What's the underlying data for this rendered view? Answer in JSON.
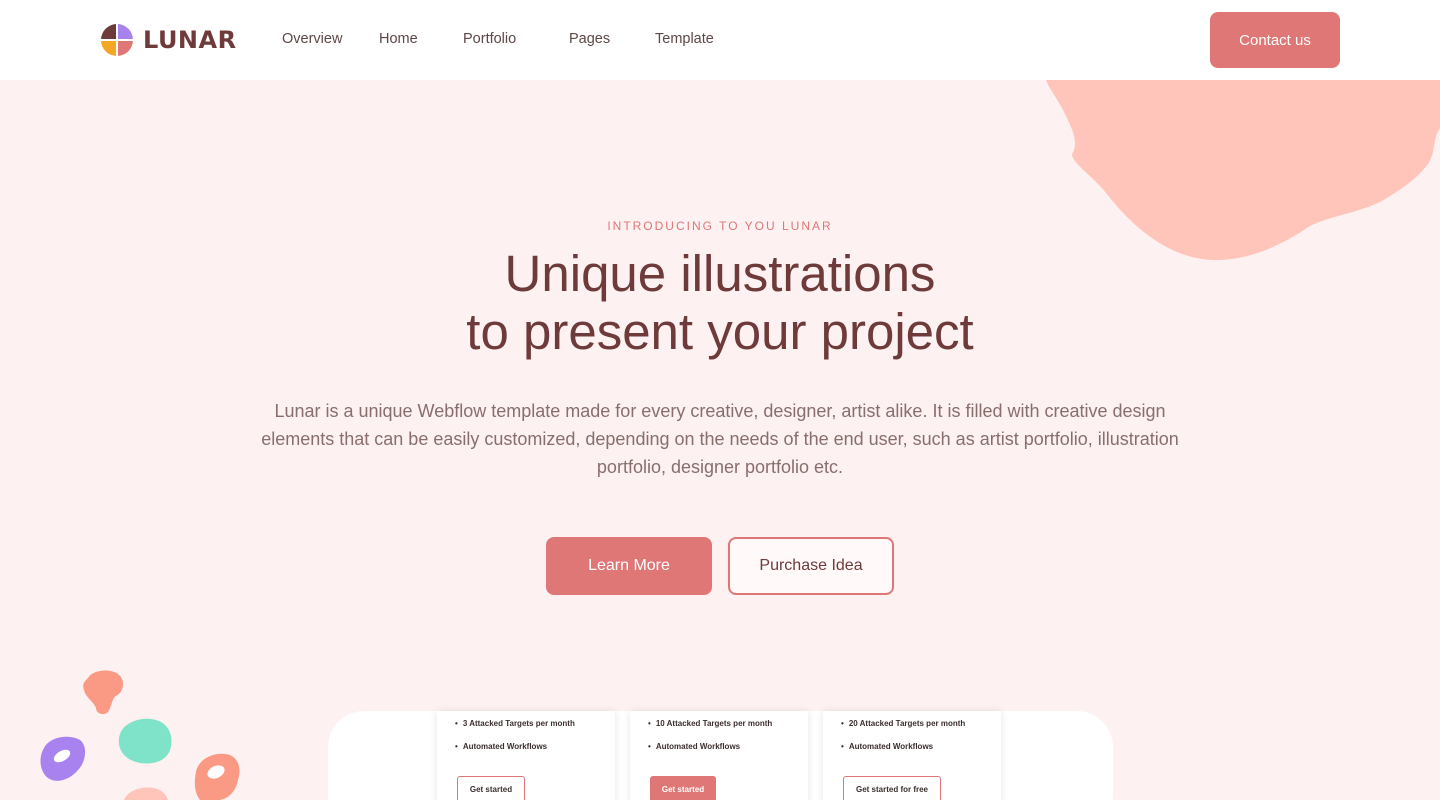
{
  "header": {
    "logo_text": "LUNAR",
    "nav": [
      {
        "label": "Overview"
      },
      {
        "label": "Home"
      },
      {
        "label": "Portfolio"
      },
      {
        "label": "Pages"
      },
      {
        "label": "Template"
      }
    ],
    "contact_label": "Contact us"
  },
  "hero": {
    "eyebrow": "INTRODUCING TO YOU LUNAR",
    "title_line1": "Unique illustrations",
    "title_line2": "to present your project",
    "description": "Lunar is a unique Webflow template made for every creative, designer, artist alike. It is filled with creative design elements that can be easily customized, depending on the needs of the end user, such as artist portfolio, illustration portfolio, designer portfolio etc.",
    "primary_button": "Learn More",
    "secondary_button": "Purchase Idea"
  },
  "pricing_preview": {
    "cards": [
      {
        "feature1": "3 Attacked Targets per month",
        "feature2": "Automated Workflows",
        "button": "Get started"
      },
      {
        "feature1": "10 Attacked Targets per month",
        "feature2": "Automated Workflows",
        "button": "Get started"
      },
      {
        "feature1": "20 Attacked Targets per month",
        "feature2": "Automated Workflows",
        "button": "Get started for free"
      }
    ]
  },
  "colors": {
    "accent": "#e07777",
    "brand_text": "#6e3a3a",
    "background": "#fdf1f1",
    "blob": "#ffc5bb",
    "splash_orange": "#fb9a84",
    "splash_teal": "#7ee3c8",
    "splash_purple": "#a882ee"
  },
  "icons": {
    "logo": "lunar-quadrant-logo-icon"
  }
}
